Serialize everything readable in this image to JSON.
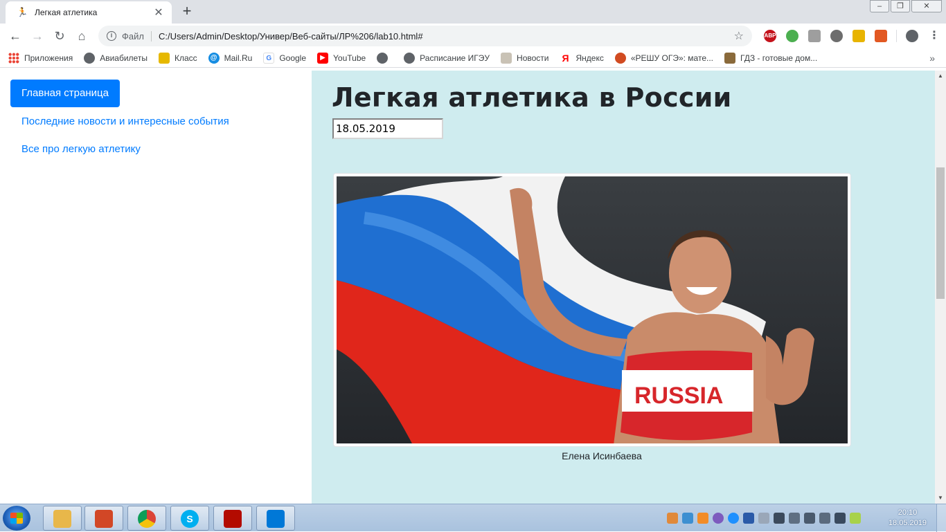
{
  "browser": {
    "tab": {
      "title": "Легкая атлетика",
      "favicon": "runner-icon",
      "close": "✕"
    },
    "new_tab": "+",
    "window_controls": {
      "minimize": "–",
      "restore": "❐",
      "close": "✕"
    },
    "omnibox": {
      "scheme": "Файл",
      "url": "C:/Users/Admin/Desktop/Универ/Веб-сайты/ЛР%206/lab10.html#"
    },
    "extensions": [
      "abp-icon",
      "speed-dial-icon",
      "pdf-ext-icon",
      "vpn-icon",
      "bookmark-ext-icon",
      "office-icon"
    ],
    "extension_labels": {
      "abp": "ABP"
    },
    "bookmarks": [
      {
        "label": "Приложения",
        "icon": "apps-grid-icon",
        "glyph": ""
      },
      {
        "label": "Авиабилеты",
        "icon": "globe-icon",
        "glyph": ""
      },
      {
        "label": "Класс",
        "icon": "klass-icon",
        "glyph": ""
      },
      {
        "label": "Mail.Ru",
        "icon": "mailru-icon",
        "glyph": "@"
      },
      {
        "label": "Google",
        "icon": "google-icon",
        "glyph": "G"
      },
      {
        "label": "YouTube",
        "icon": "youtube-icon",
        "glyph": "▶"
      },
      {
        "label": "",
        "icon": "globe-icon",
        "glyph": ""
      },
      {
        "label": "Расписание ИГЭУ",
        "icon": "globe-icon",
        "glyph": ""
      },
      {
        "label": "Новости",
        "icon": "news-icon",
        "glyph": ""
      },
      {
        "label": "Яндекс",
        "icon": "yandex-icon",
        "glyph": "Я"
      },
      {
        "label": "«РЕШУ ОГЭ»: мате...",
        "icon": "reshu-icon",
        "glyph": ""
      },
      {
        "label": "ГДЗ - готовые дом...",
        "icon": "gdz-icon",
        "glyph": ""
      }
    ],
    "bookmarks_more": "»"
  },
  "sidebar": {
    "active": "Главная страница",
    "links": [
      "Последние новости и интересные события",
      "Все про легкую атлетику"
    ]
  },
  "main": {
    "title": "Легкая атлетика в России",
    "date_value": "18.05.2019",
    "figure_caption": "Елена Исинбаева",
    "photo_text": "RUSSIA"
  },
  "taskbar": {
    "apps": [
      "explorer-icon",
      "paint-icon",
      "chrome-icon",
      "skype-icon",
      "acrobat-icon",
      "vscode-icon"
    ],
    "time": "20:10",
    "date": "18.05.2019"
  },
  "colors": {
    "accent": "#007bff",
    "content_bg": "#cfecef",
    "title": "#212529"
  }
}
